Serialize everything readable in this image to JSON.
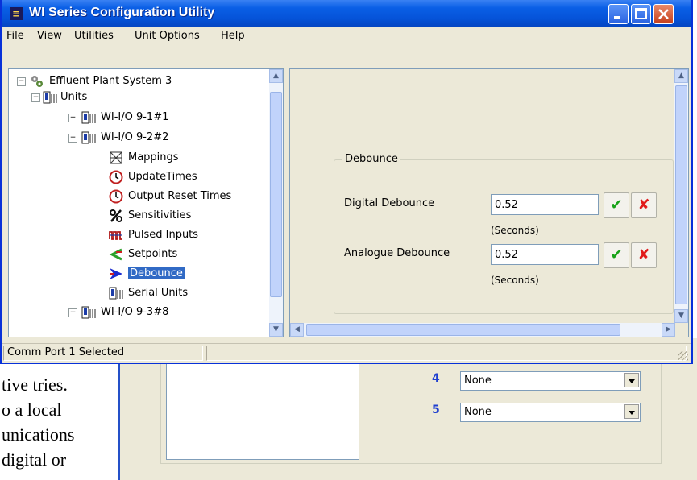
{
  "document_behind": {
    "lines": [
      "tive tries.",
      "o a local",
      "unications",
      "digital or"
    ]
  },
  "background_window": {
    "rows": [
      {
        "number": "4",
        "value": "None"
      },
      {
        "number": "5",
        "value": "None"
      }
    ]
  },
  "window": {
    "title": "WI Series Configuration Utility",
    "menu": [
      "File",
      "View",
      "Utilities",
      "Unit Options",
      "Help"
    ],
    "tree": [
      {
        "label": "Effluent Plant System 3",
        "icon": "system-gears-icon",
        "expander": "−"
      },
      {
        "label": "Units",
        "icon": "unit-device-icon",
        "expander": "−"
      },
      {
        "label": "WI-I/O 9-1#1",
        "icon": "unit-device-icon",
        "expander": "+"
      },
      {
        "label": "WI-I/O 9-2#2",
        "icon": "unit-device-icon",
        "expander": "−"
      },
      {
        "label": "Mappings",
        "icon": "mappings-icon"
      },
      {
        "label": "UpdateTimes",
        "icon": "clock-icon"
      },
      {
        "label": "Output Reset Times",
        "icon": "clock-icon"
      },
      {
        "label": "Sensitivities",
        "icon": "percent-icon"
      },
      {
        "label": "Pulsed Inputs",
        "icon": "pulse-icon"
      },
      {
        "label": "Setpoints",
        "icon": "setpoint-arrow-icon"
      },
      {
        "label": "Debounce",
        "icon": "debounce-arrow-icon",
        "selected": true
      },
      {
        "label": "Serial Units",
        "icon": "unit-device-icon"
      },
      {
        "label": "WI-I/O 9-3#8",
        "icon": "unit-device-icon",
        "expander": "+"
      }
    ],
    "debounce": {
      "group_title": "Debounce",
      "digital_label": "Digital Debounce",
      "digital_value": "0.52",
      "digital_units": "(Seconds)",
      "analogue_label": "Analogue Debounce",
      "analogue_value": "0.52",
      "analogue_units": "(Seconds)",
      "colors": {
        "accept": "#18a318",
        "reject": "#e11b1b"
      }
    },
    "status": "Comm Port 1 Selected"
  }
}
